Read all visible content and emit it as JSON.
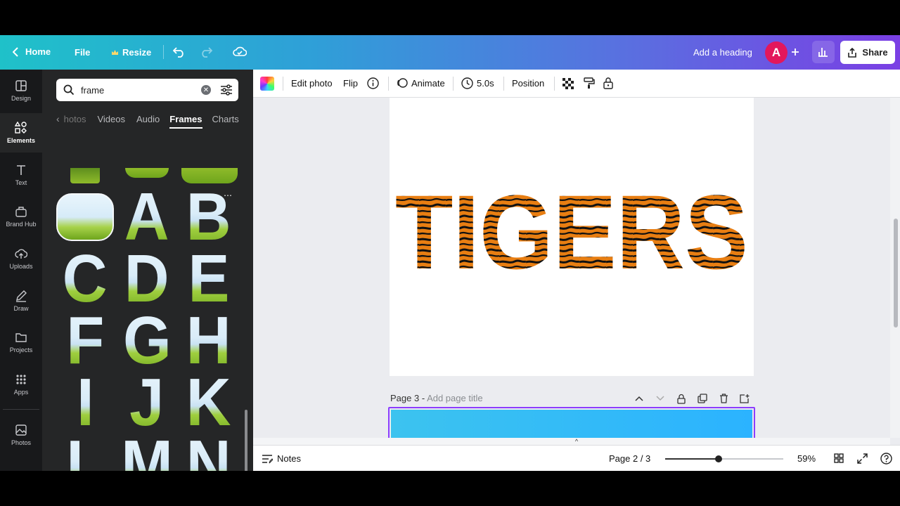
{
  "topbar": {
    "home_label": "Home",
    "file_label": "File",
    "resize_label": "Resize",
    "add_heading_label": "Add a heading",
    "avatar_initial": "A",
    "share_label": "Share",
    "accent_color": "#e3175c"
  },
  "rail": {
    "items": [
      {
        "label": "Design",
        "icon": "layout-icon"
      },
      {
        "label": "Elements",
        "icon": "shapes-icon"
      },
      {
        "label": "Text",
        "icon": "text-icon"
      },
      {
        "label": "Brand Hub",
        "icon": "brand-icon"
      },
      {
        "label": "Uploads",
        "icon": "cloud-upload-icon"
      },
      {
        "label": "Draw",
        "icon": "pen-icon"
      },
      {
        "label": "Projects",
        "icon": "folder-icon"
      },
      {
        "label": "Apps",
        "icon": "grid-icon"
      },
      {
        "label": "Photos",
        "icon": "image-icon"
      }
    ]
  },
  "panel": {
    "search_value": "frame",
    "tabs": [
      "hotos",
      "Videos",
      "Audio",
      "Frames",
      "Charts"
    ],
    "active_tab": "Frames",
    "letters": [
      "A",
      "B",
      "C",
      "D",
      "E",
      "F",
      "G",
      "H",
      "I",
      "J",
      "K",
      "L",
      "M",
      "N"
    ]
  },
  "toolbar": {
    "edit_photo": "Edit photo",
    "flip": "Flip",
    "animate": "Animate",
    "duration": "5.0s",
    "position": "Position"
  },
  "canvas": {
    "heading_text": "TIGERS",
    "page3_prefix": "Page 3 -",
    "page3_placeholder": "Add page title"
  },
  "bottombar": {
    "notes_label": "Notes",
    "page_indicator": "Page 2 / 3",
    "zoom": "59%",
    "zoom_fraction": 0.45
  }
}
